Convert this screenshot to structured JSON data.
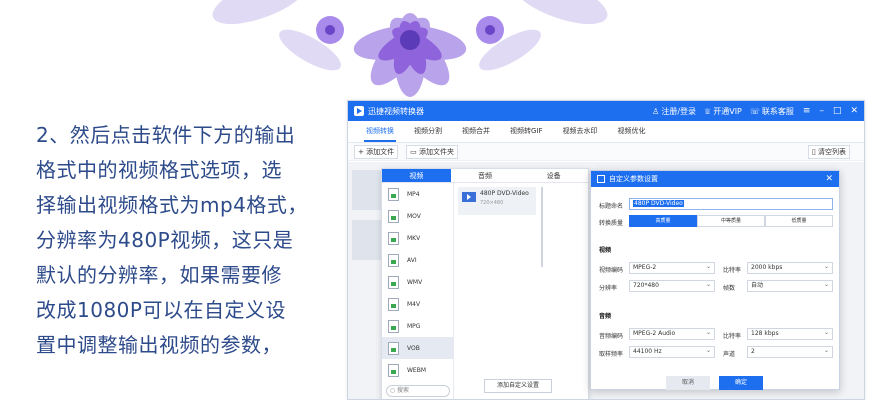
{
  "article": {
    "lines": [
      "2、然后点击软件下方的输出",
      "格式中的视频格式选项，选",
      "择输出视频格式为mp4格式，",
      "分辨率为480P视频，这只是",
      "默认的分辨率，如果需要修",
      "改成1080P可以在自定义设",
      "置中调整输出视频的参数，"
    ]
  },
  "app": {
    "title": "迅捷视频转换器",
    "login": "注册/登录",
    "vip": "开通VIP",
    "support": "联系客服",
    "tabs": [
      "视频转换",
      "视频分割",
      "视频合并",
      "视频转GIF",
      "视频去水印",
      "视频优化"
    ],
    "toolbar": {
      "add_file": "添加文件",
      "add_folder": "添加文件夹",
      "clear_list": "清空列表"
    }
  },
  "format_panel": {
    "tabs": [
      "视频",
      "音频",
      "设备"
    ],
    "formats": [
      "MP4",
      "MOV",
      "MKV",
      "AVI",
      "WMV",
      "M4V",
      "MPG",
      "VOB",
      "WEBM"
    ],
    "search_placeholder": "搜索",
    "preset": {
      "name": "480P DVD-Video",
      "size": "720×480"
    },
    "add_custom": "添加自定义设置"
  },
  "dialog": {
    "title": "自定义参数设置",
    "title_label": "标题命名",
    "title_value": "480P DVD-Video",
    "quality_label": "转换质量",
    "quality_options": [
      "高质量",
      "中等质量",
      "低质量"
    ],
    "video_section": "视频",
    "video_codec_label": "视频编码",
    "video_codec": "MPEG-2",
    "bitrate_label": "比特率",
    "bitrate": "2000 kbps",
    "resolution_label": "分辨率",
    "resolution": "720*480",
    "fps_label": "帧数",
    "fps": "自动",
    "audio_section": "音频",
    "audio_codec_label": "音频编码",
    "audio_codec": "MPEG-2 Audio",
    "audio_bitrate_label": "比特率",
    "audio_bitrate": "128 kbps",
    "sample_label": "取样频率",
    "sample": "44100 Hz",
    "channel_label": "声道",
    "channel": "2",
    "cancel": "取消",
    "ok": "确定"
  },
  "colors": {
    "accent": "#1e6ff0",
    "text_blue": "#2d4a8a",
    "petal": "#9b6fe0"
  }
}
